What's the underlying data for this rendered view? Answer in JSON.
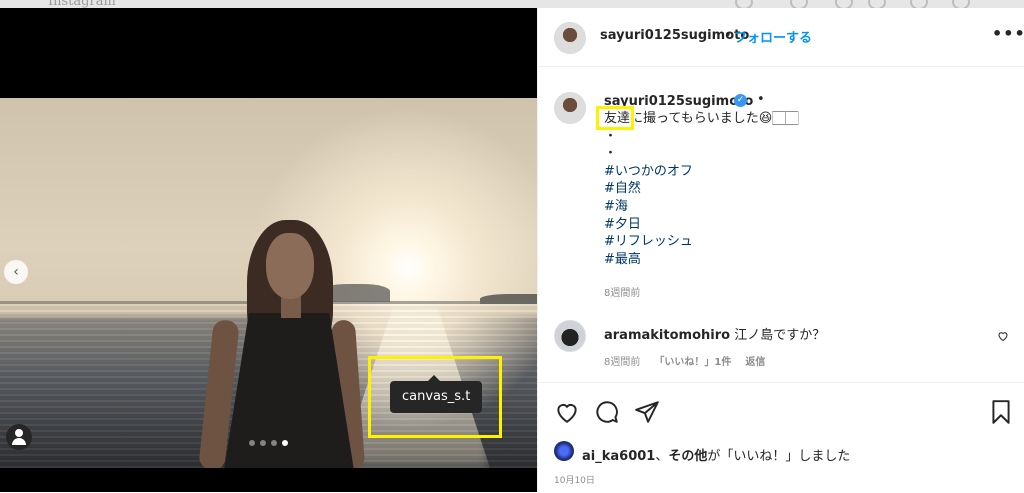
{
  "nav": {
    "logo_text": "Instagram",
    "icons": [
      "home-icon",
      "messenger-icon",
      "explore-icon",
      "heart-icon",
      "profile-avatar"
    ]
  },
  "photo": {
    "tag_label": "canvas_s.t",
    "carousel": {
      "total": 4,
      "active_index": 3
    },
    "prev_glyph": "‹"
  },
  "header": {
    "username": "sayuri0125sugimoto",
    "separator": "•",
    "follow_label": "フォローする",
    "more_glyph": "•••"
  },
  "caption": {
    "username": "sayuri0125sugimoto",
    "dot": "•",
    "first_line_highlight": "友達",
    "first_line_rest": "に撮ってもらいました😆🏻🏻",
    "dot_lines": [
      "・",
      "・"
    ],
    "hashtags": [
      "#いつかのオフ",
      "#自然",
      "#海",
      "#夕日",
      "#リフレッシュ",
      "#最高"
    ],
    "time": "8週間前"
  },
  "comment": {
    "username": "aramakitomohiro",
    "text": "江ノ島ですか？",
    "time": "8週間前",
    "likes": "「いいね！」1件",
    "reply": "返信"
  },
  "likes_line": {
    "user": "ai_ka6001",
    "sep": "、",
    "others": "その他",
    "suffix": "が「いいね！」しました"
  },
  "date": "10月10日",
  "colors": {
    "accent": "#0095f6",
    "hashtag": "#00376b",
    "highlight": "#fff200",
    "muted": "#8e8e8e"
  }
}
